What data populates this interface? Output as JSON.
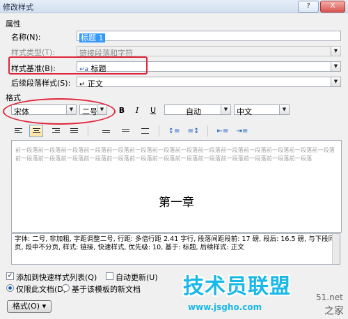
{
  "window": {
    "title": "修改样式",
    "controls": {
      "help": "?",
      "close": "X"
    }
  },
  "properties": {
    "section_label": "属性",
    "name": {
      "label": "名称(N):",
      "value": "标题 1"
    },
    "style_type": {
      "label": "样式类型(T):",
      "value": "链接段落和字符"
    },
    "style_based_on": {
      "label": "样式基准(B):",
      "value": "标题",
      "icon": "paragraph-char-icon"
    },
    "next_para_style": {
      "label": "后续段落样式(S):",
      "value": "正文",
      "icon": "return-arrow-icon"
    }
  },
  "format": {
    "section_label": "格式",
    "font": "宋体",
    "size": "二号",
    "bold": "B",
    "italic": "I",
    "underline": "U",
    "color": "自动",
    "script": "中文"
  },
  "preview": {
    "previous_paragraph": "前一段落前一段落前一段落前一段落前一段落前一段落前一段落前一段落前一段落前一段落前一段落前一段落前一段落前一段落前一段落前一段落前一段落前一段落前一段落前一段落前一段落前一段落前一段落前一段落前一段落前一段落前一段落",
    "heading": "第一章"
  },
  "description": "字体: 二号, 非加粗, 字距调整二号, 行距: 多倍行距 2.41 字行, 段落间距段前: 17 磅, 段后: 16.5 磅, 与下段同页, 段中不分页, 样式: 链接, 快速样式, 优先级: 10, 基于: 标题, 后续样式: 正文",
  "options": {
    "add_to_quick_styles": {
      "label": "添加到快速样式列表(Q)",
      "checked": true
    },
    "auto_update": {
      "label": "自动更新(U)",
      "checked": false
    },
    "only_this_doc": {
      "label": "仅限此文档(D)",
      "selected": true
    },
    "new_docs_template": {
      "label": "基于该模板的新文档",
      "selected": false
    }
  },
  "format_button": "格式(O) ▾",
  "watermark": {
    "brand": "技术员联盟",
    "url": "www.jsgho.com",
    "side_a": "51.net",
    "side_b": "之家"
  },
  "colors": {
    "annotation": "#e0243a",
    "selection": "#3399ff",
    "watermark": "#19b8e8"
  }
}
